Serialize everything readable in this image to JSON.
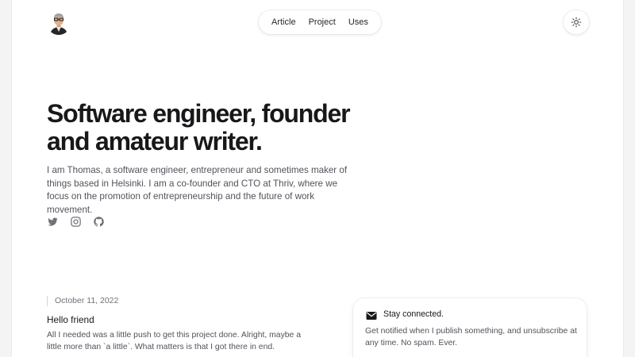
{
  "header": {
    "nav": [
      "Article",
      "Project",
      "Uses"
    ],
    "theme_toggle_icon": "sun-icon"
  },
  "hero": {
    "title": "Software engineer, founder and amateur writer.",
    "description": "I am Thomas, a software engineer, entrepreneur and sometimes maker of things based in Helsinki. I am a co-founder and CTO at Thriv, where we focus on the promotion of entrepreneurship and the future of work movement.",
    "socials": [
      "twitter-icon",
      "instagram-icon",
      "github-icon"
    ]
  },
  "article": {
    "date": "October 11, 2022",
    "title": "Hello friend",
    "excerpt": "All I needed was a little push to get this project done. Alright, maybe a little more than `a little`. What matters is that I got there in end."
  },
  "newsletter": {
    "icon": "mail-icon",
    "title": "Stay connected.",
    "description": "Get notified when I publish something, and unsubscribe at any time. No spam. Ever."
  },
  "colors": {
    "background": "#f4f4f5",
    "card": "#ffffff",
    "text_primary": "#18181b",
    "text_secondary": "#52525b"
  }
}
